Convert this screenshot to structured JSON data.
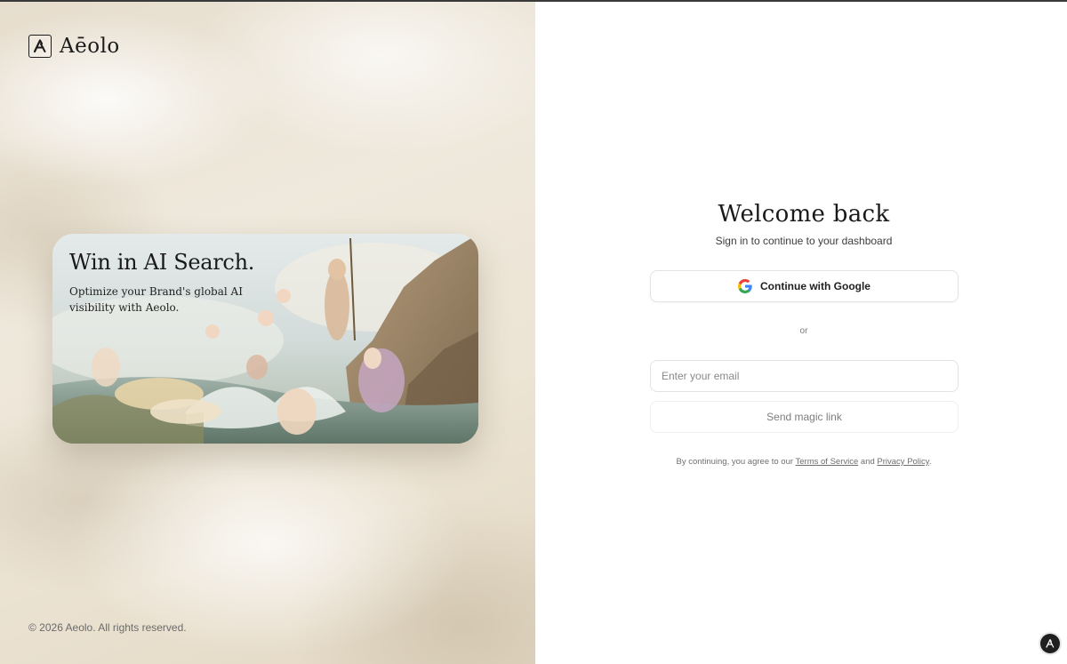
{
  "brand": {
    "name": "Aēolo",
    "logo_icon": "aeolo-logo-icon"
  },
  "hero": {
    "title": "Win in AI Search.",
    "subtitle": "Optimize your Brand's global AI visibility with Aeolo."
  },
  "footer": {
    "copyright": "© 2026 Aeolo. All rights reserved."
  },
  "auth": {
    "title": "Welcome back",
    "subtitle": "Sign in to continue to your dashboard",
    "google_button_label": "Continue with Google",
    "google_icon": "google-icon",
    "divider_text": "or",
    "email_placeholder": "Enter your email",
    "email_value": "",
    "magic_link_label": "Send magic link",
    "terms_prefix": "By continuing, you agree to our",
    "terms_link": "Terms of Service",
    "terms_and": "and",
    "privacy_link": "Privacy Policy",
    "terms_suffix": "."
  },
  "floating_button": {
    "icon": "aeolo-logo-icon"
  },
  "colors": {
    "text_primary": "#1a1a1a",
    "border": "#e3e3e3",
    "muted": "#7d7d7d",
    "google_blue": "#4285F4",
    "google_red": "#EA4335",
    "google_yellow": "#FBBC05",
    "google_green": "#34A853"
  }
}
